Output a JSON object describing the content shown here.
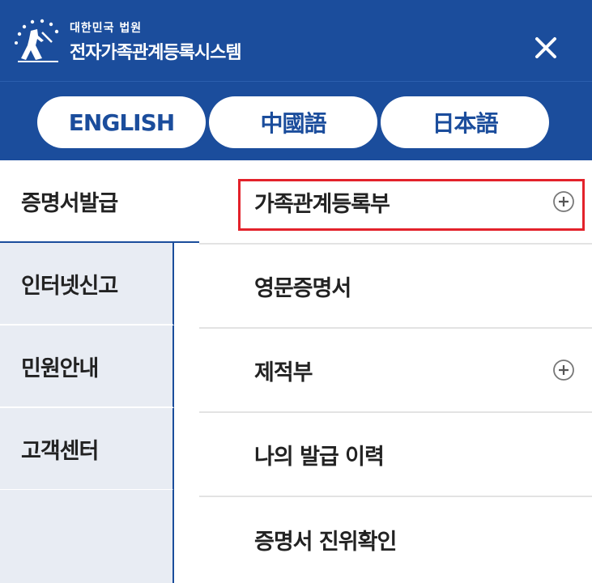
{
  "header": {
    "org_small": "대한민국 법원",
    "org_title": "전자가족관계등록시스템",
    "close_icon": "close-icon",
    "bg_color": "#1b4d9c"
  },
  "languages": [
    {
      "label": "ENGLISH"
    },
    {
      "label": "中國語"
    },
    {
      "label": "日本語"
    }
  ],
  "sidebar": {
    "items": [
      {
        "label": "증명서발급",
        "active": true
      },
      {
        "label": "인터넷신고"
      },
      {
        "label": "민원안내"
      },
      {
        "label": "고객센터"
      }
    ]
  },
  "submenu": {
    "items": [
      {
        "label": "가족관계등록부",
        "expandable": true,
        "highlighted": true
      },
      {
        "label": "영문증명서",
        "expandable": false
      },
      {
        "label": "제적부",
        "expandable": true
      },
      {
        "label": "나의 발급 이력",
        "expandable": false
      },
      {
        "label": "증명서 진위확인",
        "expandable": false
      }
    ]
  },
  "colors": {
    "accent": "#1b4d9c",
    "highlight": "#e3222b",
    "sidebar_bg": "#e8ecf3"
  }
}
